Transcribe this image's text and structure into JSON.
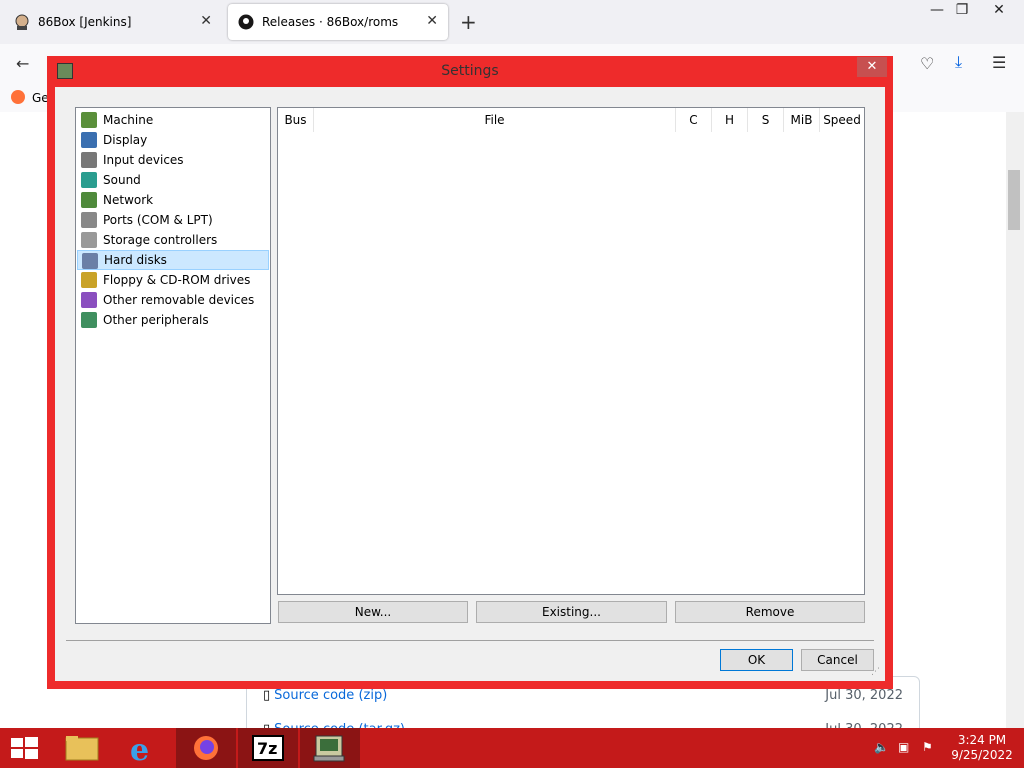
{
  "browser": {
    "tabs": [
      {
        "title": "86Box [Jenkins]",
        "icon": "jenkins-icon"
      },
      {
        "title": "Releases · 86Box/roms",
        "icon": "github-icon"
      }
    ],
    "bookmark_label": "Ge"
  },
  "page": {
    "assets": [
      {
        "label": "Source code",
        "suffix": "(zip)",
        "date": "Jul 30, 2022"
      },
      {
        "label": "Source code",
        "suffix": "(tar.gz)",
        "date": "Jul 30, 2022"
      }
    ]
  },
  "dialog": {
    "title": "Settings",
    "categories": [
      {
        "label": "Machine",
        "icon": "machine-icon",
        "color": "#5a8f3a"
      },
      {
        "label": "Display",
        "icon": "display-icon",
        "color": "#3a6fb0"
      },
      {
        "label": "Input devices",
        "icon": "input-devices-icon",
        "color": "#777777"
      },
      {
        "label": "Sound",
        "icon": "sound-icon",
        "color": "#2a9d8f"
      },
      {
        "label": "Network",
        "icon": "network-icon",
        "color": "#4f8a3b"
      },
      {
        "label": "Ports (COM & LPT)",
        "icon": "ports-icon",
        "color": "#888888"
      },
      {
        "label": "Storage controllers",
        "icon": "storage-controllers-icon",
        "color": "#999999"
      },
      {
        "label": "Hard disks",
        "icon": "hard-disk-icon",
        "color": "#6b7fa6"
      },
      {
        "label": "Floppy & CD-ROM drives",
        "icon": "floppy-cdrom-icon",
        "color": "#c9a227"
      },
      {
        "label": "Other removable devices",
        "icon": "removable-devices-icon",
        "color": "#8a4fbf"
      },
      {
        "label": "Other peripherals",
        "icon": "peripherals-icon",
        "color": "#3f8f5f"
      }
    ],
    "selected_category": "Hard disks",
    "columns": [
      "Bus",
      "File",
      "C",
      "H",
      "S",
      "MiB",
      "Speed"
    ],
    "buttons": {
      "new": "New...",
      "existing": "Existing...",
      "remove": "Remove",
      "ok": "OK",
      "cancel": "Cancel"
    }
  },
  "taskbar": {
    "apps": [
      {
        "name": "file-explorer-icon"
      },
      {
        "name": "internet-explorer-icon"
      },
      {
        "name": "firefox-icon"
      },
      {
        "name": "7zip-icon",
        "label": "7z"
      },
      {
        "name": "86box-icon"
      }
    ],
    "time": "3:24 PM",
    "date": "9/25/2022"
  }
}
